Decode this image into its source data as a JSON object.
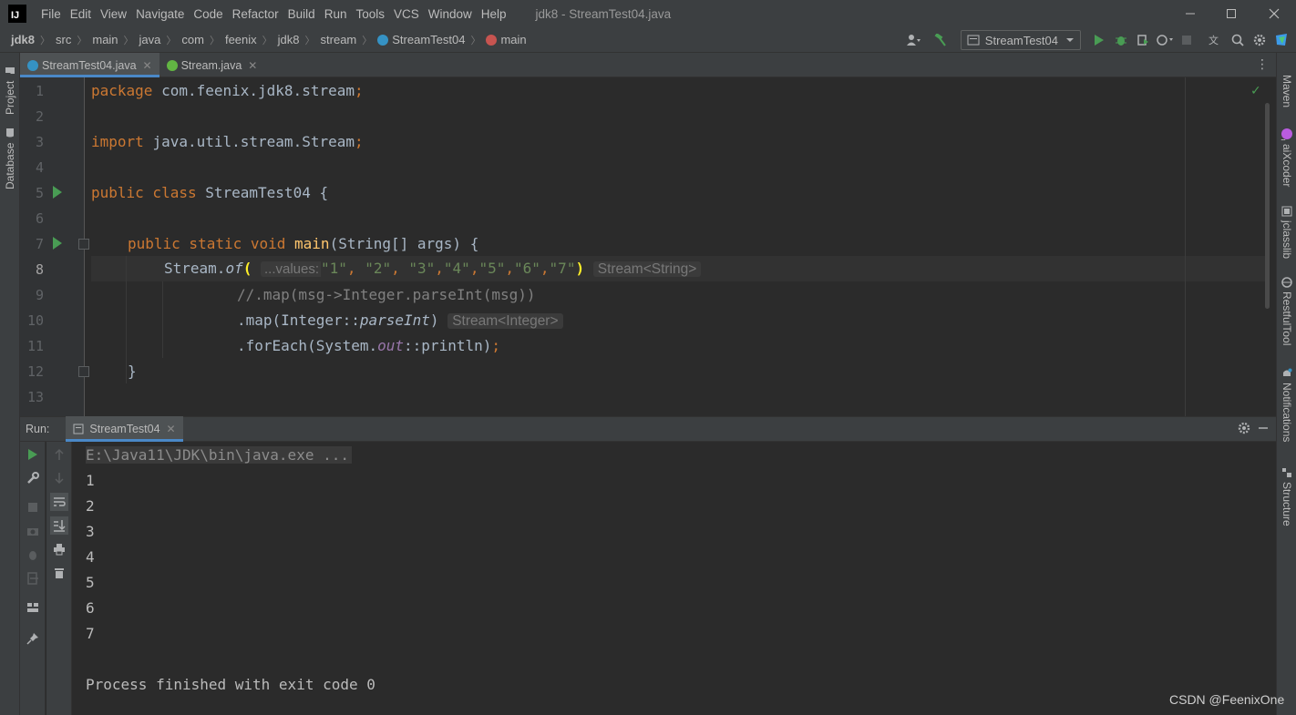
{
  "menu": {
    "items": [
      "File",
      "Edit",
      "View",
      "Navigate",
      "Code",
      "Refactor",
      "Build",
      "Run",
      "Tools",
      "VCS",
      "Window",
      "Help"
    ],
    "window_title": "jdk8 - StreamTest04.java"
  },
  "breadcrumb": [
    "jdk8",
    "src",
    "main",
    "java",
    "com",
    "feenix",
    "jdk8",
    "stream",
    "StreamTest04",
    "main"
  ],
  "toolbar": {
    "run_config": "StreamTest04"
  },
  "left_stripe": {
    "tabs": [
      "Project",
      "Database"
    ]
  },
  "right_stripe": {
    "tabs": [
      "Maven",
      "aiXcoder",
      "jclasslib",
      "RestfulTool",
      "Notifications",
      "Structure"
    ]
  },
  "editor_tabs": [
    {
      "label": "StreamTest04.java",
      "active": true
    },
    {
      "label": "Stream.java",
      "active": false
    }
  ],
  "editor": {
    "line_numbers": [
      "1",
      "2",
      "3",
      "4",
      "5",
      "6",
      "7",
      "8",
      "9",
      "10",
      "11",
      "12",
      "13"
    ],
    "lines": {
      "l1_kw": "package ",
      "l1_rest": "com.feenix.jdk8.stream",
      "l1_semi": ";",
      "l3_kw": "import ",
      "l3_rest": "java.util.stream.Stream",
      "l3_semi": ";",
      "l5_kw": "public class ",
      "l5_rest": "StreamTest04 {",
      "l7_kw": "public static void ",
      "l7_fn": "main",
      "l7_rest": "(String[] args) {",
      "l8_a": "Stream.",
      "l8_of": "of",
      "l8_open": "(",
      "l8_inlay": "...values:",
      "l8_args": [
        "\"1\"",
        ", ",
        "\"2\"",
        ", ",
        "\"3\"",
        ",",
        "\"4\"",
        ",",
        "\"5\"",
        ",",
        "\"6\"",
        ",",
        "\"7\""
      ],
      "l8_close": ")",
      "l8_hint": "Stream<String>",
      "l9_comment": "//.map(msg->Integer.parseInt(msg))",
      "l10_a": ".map(Integer::",
      "l10_it": "parseInt",
      "l10_b": ")",
      "l10_hint": "Stream<Integer>",
      "l11_a": ".forEach(System.",
      "l11_out": "out",
      "l11_b": "::println)",
      "l11_semi": ";",
      "l12": "}"
    }
  },
  "run_panel": {
    "label": "Run:",
    "tab": "StreamTest04",
    "console": {
      "command": "E:\\Java11\\JDK\\bin\\java.exe ...",
      "output": [
        "1",
        "2",
        "3",
        "4",
        "5",
        "6",
        "7"
      ],
      "exit": "Process finished with exit code 0"
    }
  },
  "watermark": "CSDN @FeenixOne",
  "colors": {
    "keyword": "#cc7832",
    "string": "#6a8759",
    "method_decl": "#ffc66d",
    "static_field": "#9876aa",
    "comment": "#808080",
    "run_green": "#499c54",
    "accent_blue": "#4a88c7"
  }
}
